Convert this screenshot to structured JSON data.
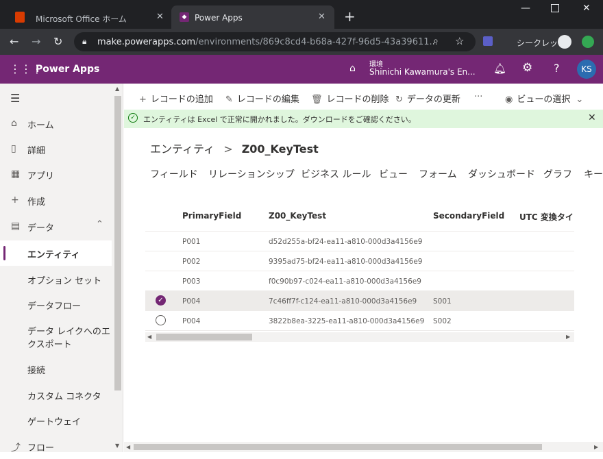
{
  "browser": {
    "tabs": [
      {
        "title": "Microsoft Office ホーム",
        "icon": "office-icon"
      },
      {
        "title": "Power Apps",
        "icon": "powerapps-icon"
      }
    ],
    "new_tab": "+",
    "url_host": "make.powerapps.com",
    "url_path": "/environments/869c8cd4-b68a-427f-96d5-43a39611...",
    "incognito_label": "シークレット"
  },
  "app": {
    "name": "Power Apps",
    "env_label": "環境",
    "env_name": "Shinichi Kawamura's En...",
    "avatar": "KS"
  },
  "sidebar": {
    "items": [
      {
        "label": "ホーム",
        "icon": "home-icon"
      },
      {
        "label": "詳細",
        "icon": "book-icon"
      },
      {
        "label": "アプリ",
        "icon": "apps-icon"
      },
      {
        "label": "作成",
        "icon": "plus-icon"
      },
      {
        "label": "データ",
        "icon": "table-icon"
      },
      {
        "label": "エンティティ"
      },
      {
        "label": "オプション セット"
      },
      {
        "label": "データフロー"
      },
      {
        "label": "データ レイクへのエ"
      },
      {
        "label": "クスポート"
      },
      {
        "label": "接続"
      },
      {
        "label": "カスタム コネクタ"
      },
      {
        "label": "ゲートウェイ"
      },
      {
        "label": "フロー",
        "icon": "flow-icon"
      }
    ]
  },
  "commands": {
    "add": "レコードの追加",
    "edit": "レコードの編集",
    "delete": "レコードの削除",
    "refresh": "データの更新",
    "more": "···",
    "view": "ビューの選択"
  },
  "message": "エンティティは Excel で正常に開かれました。ダウンロードをご確認ください。",
  "breadcrumb": {
    "parent": "エンティティ",
    "sep": ">",
    "current": "Z00_KeyTest"
  },
  "page_tabs": [
    "フィールド",
    "リレーションシップ",
    "ビジネス ルール",
    "ビュー",
    "フォーム",
    "ダッシュボード",
    "グラフ",
    "キー"
  ],
  "table": {
    "columns": [
      "PrimaryField",
      "Z00_KeyTest",
      "SecondaryField",
      "UTC 変換タイ..."
    ],
    "rows": [
      {
        "primary": "P001",
        "key": "d52d255a-bf24-ea11-a810-000d3a4156e9",
        "secondary": "",
        "selected": false
      },
      {
        "primary": "P002",
        "key": "9395ad75-bf24-ea11-a810-000d3a4156e9",
        "secondary": "",
        "selected": false
      },
      {
        "primary": "P003",
        "key": "f0c90b97-c024-ea11-a810-000d3a4156e9",
        "secondary": "",
        "selected": false
      },
      {
        "primary": "P004",
        "key": "7c46ff7f-c124-ea11-a810-000d3a4156e9",
        "secondary": "S001",
        "selected": true
      },
      {
        "primary": "P004",
        "key": "3822b8ea-3225-ea11-a810-000d3a4156e9",
        "secondary": "S002",
        "selected": false
      }
    ]
  },
  "colors": {
    "brand": "#742774",
    "success_bg": "#dff6dd",
    "success_icon": "#107c10"
  }
}
